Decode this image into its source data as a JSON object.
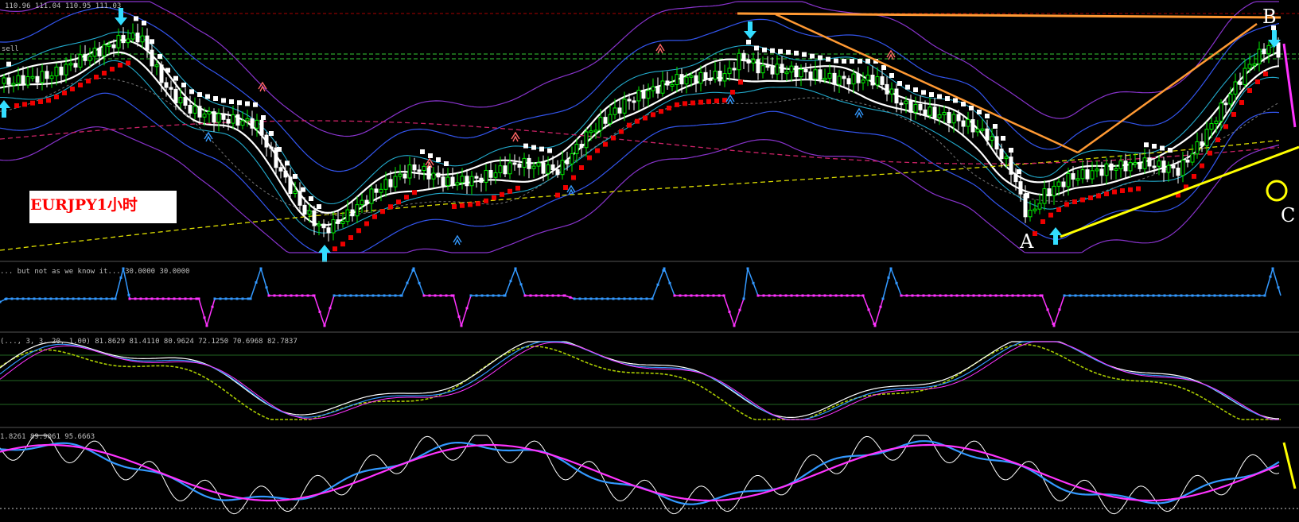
{
  "chart_data": [
    {
      "type": "line",
      "title": "EURJPY1小时",
      "header": "110.96 111.04 110.95 111.03",
      "extra_label": "sell",
      "symbol": "EURJPY",
      "timeframe": "1小时",
      "point_labels": [
        "A",
        "B",
        "C"
      ],
      "price_ohlc": [
        110.96,
        111.04,
        110.95,
        111.03
      ],
      "colors": {
        "background": "#000000",
        "bull_candle": "#00ff00",
        "bear_candle": "#ffffff",
        "trendline_orange": "#ff9933",
        "trendline_yellow": "#ffff00",
        "arrow": "#33ddff",
        "title_red": "#ff0000"
      }
    },
    {
      "type": "line",
      "header": "... but not as we know it... 30.0000 30.0000",
      "series_colors": [
        "#3399ff",
        "#ff33ff"
      ],
      "levels": [
        30.0,
        30.0
      ]
    },
    {
      "type": "line",
      "header": "(..., 3, 3, 20, 1.00) 81.8629 81.4110 80.9624 72.1250 70.6968 82.7837",
      "values": [
        81.8629,
        81.411,
        80.9624,
        72.125,
        70.6968,
        82.7837
      ]
    },
    {
      "type": "line",
      "header": "1.8261 89.9061 95.6663",
      "values": [
        1.8261,
        89.9061,
        95.6663
      ]
    }
  ]
}
